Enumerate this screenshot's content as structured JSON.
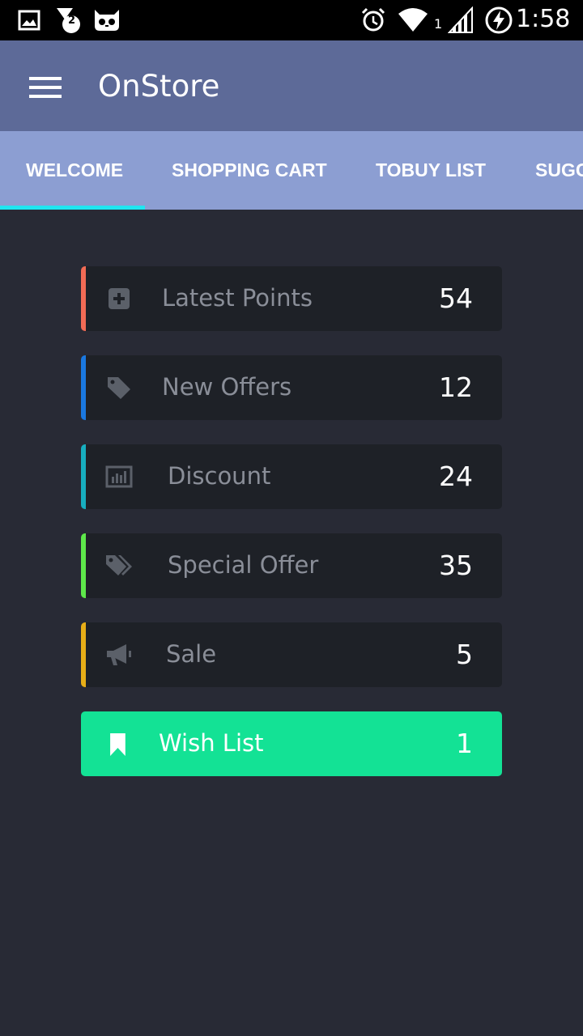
{
  "status_bar": {
    "time": "1:58",
    "notification_count": "2",
    "signal_sim": "1",
    "icons": [
      "image-icon",
      "notification-badge-icon",
      "cyanogen-mascot-icon",
      "alarm-icon",
      "wifi-icon",
      "cell-signal-icon",
      "battery-charging-icon"
    ]
  },
  "app_bar": {
    "title": "OnStore",
    "menu_icon": "hamburger-menu-icon",
    "color": "#5d6a98"
  },
  "tabs": {
    "items": [
      {
        "label": "WELCOME",
        "selected": true
      },
      {
        "label": "SHOPPING CART",
        "selected": false
      },
      {
        "label": "TOBUY LIST",
        "selected": false
      },
      {
        "label": "SUGG",
        "selected": false
      }
    ],
    "indicator_color": "#1fe6f0",
    "background": "#8c9ed2"
  },
  "items": [
    {
      "label": "Latest Points",
      "count": "54",
      "icon": "plus-square-icon",
      "accent": "#f26b55"
    },
    {
      "label": "New Offers",
      "count": "12",
      "icon": "tag-icon",
      "accent": "#1a78e0"
    },
    {
      "label": "Discount",
      "count": "24",
      "icon": "bar-chart-icon",
      "accent": "#17aebf"
    },
    {
      "label": "Special Offer",
      "count": "35",
      "icon": "tags-icon",
      "accent": "#5ee84a"
    },
    {
      "label": "Sale",
      "count": "5",
      "icon": "megaphone-icon",
      "accent": "#e8ae17"
    },
    {
      "label": "Wish List",
      "count": "1",
      "icon": "bookmark-icon",
      "accent": "#13e295",
      "highlighted": true
    }
  ],
  "colors": {
    "background": "#282a35",
    "card": "#1e2127",
    "highlight": "#13e295"
  }
}
